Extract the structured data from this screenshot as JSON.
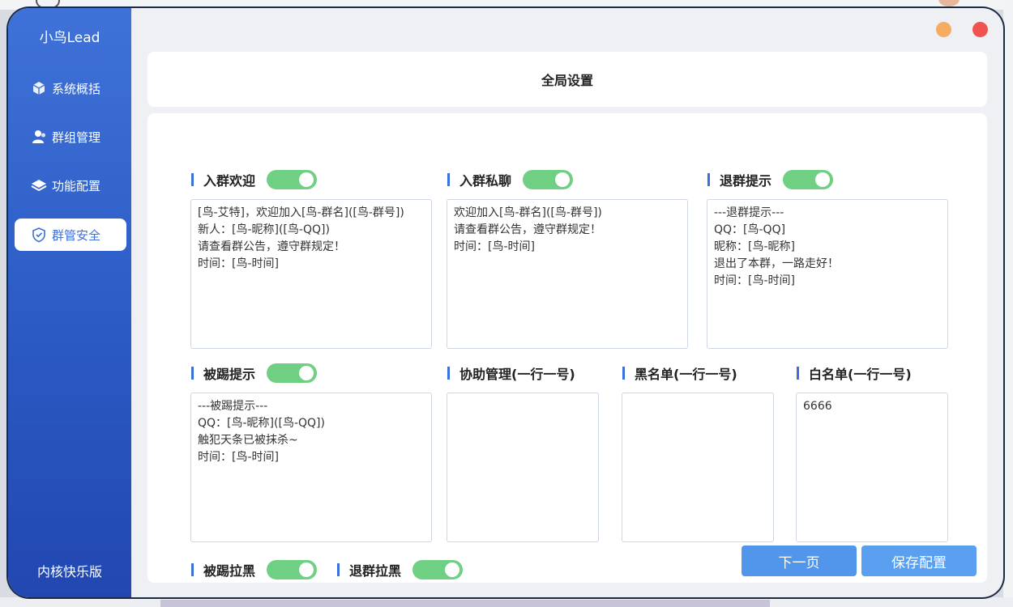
{
  "app": {
    "title": "小鸟Lead",
    "version": "内核快乐版"
  },
  "sidebar": {
    "items": [
      {
        "label": "系统概括",
        "icon": "cube-icon",
        "active": false
      },
      {
        "label": "群组管理",
        "icon": "user-icon",
        "active": false
      },
      {
        "label": "功能配置",
        "icon": "layers-icon",
        "active": false
      },
      {
        "label": "群管安全",
        "icon": "shield-icon",
        "active": true
      }
    ]
  },
  "header": {
    "title": "全局设置"
  },
  "sections": {
    "join_welcome": {
      "label": "入群欢迎",
      "enabled": true,
      "text": "[鸟-艾特]，欢迎加入[鸟-群名]([鸟-群号])\n新人：[鸟-昵称]([鸟-QQ])\n请查看群公告，遵守群规定！\n时间：[鸟-时间]"
    },
    "join_private": {
      "label": "入群私聊",
      "enabled": true,
      "text": "欢迎加入[鸟-群名]([鸟-群号])\n请查看群公告，遵守群规定！\n时间：[鸟-时间]"
    },
    "leave_notice": {
      "label": "退群提示",
      "enabled": true,
      "text": "---退群提示---\nQQ：[鸟-QQ]\n昵称：[鸟-昵称]\n退出了本群，一路走好！\n时间：[鸟-时间]"
    },
    "kick_notice": {
      "label": "被踢提示",
      "enabled": true,
      "text": "---被踢提示---\nQQ：[鸟-昵称]([鸟-QQ])\n触犯天条已被抹杀~\n时间：[鸟-时间]"
    },
    "assist_admin": {
      "label": "协助管理(一行一号)",
      "text": ""
    },
    "blacklist": {
      "label": "黑名单(一行一号)",
      "text": ""
    },
    "whitelist": {
      "label": "白名单(一行一号)",
      "text": "6666"
    },
    "kick_blacklist": {
      "label": "被踢拉黑",
      "enabled": true
    },
    "leave_blacklist": {
      "label": "退群拉黑",
      "enabled": true
    }
  },
  "buttons": {
    "next": "下一页",
    "save": "保存配置"
  },
  "colors": {
    "sidebar": "#2f5fcb",
    "accent": "#3b6fd9",
    "toggle_on": "#6fcf82",
    "button": "#5196ea",
    "minimize": "#f6ad61",
    "close": "#f0524f"
  }
}
